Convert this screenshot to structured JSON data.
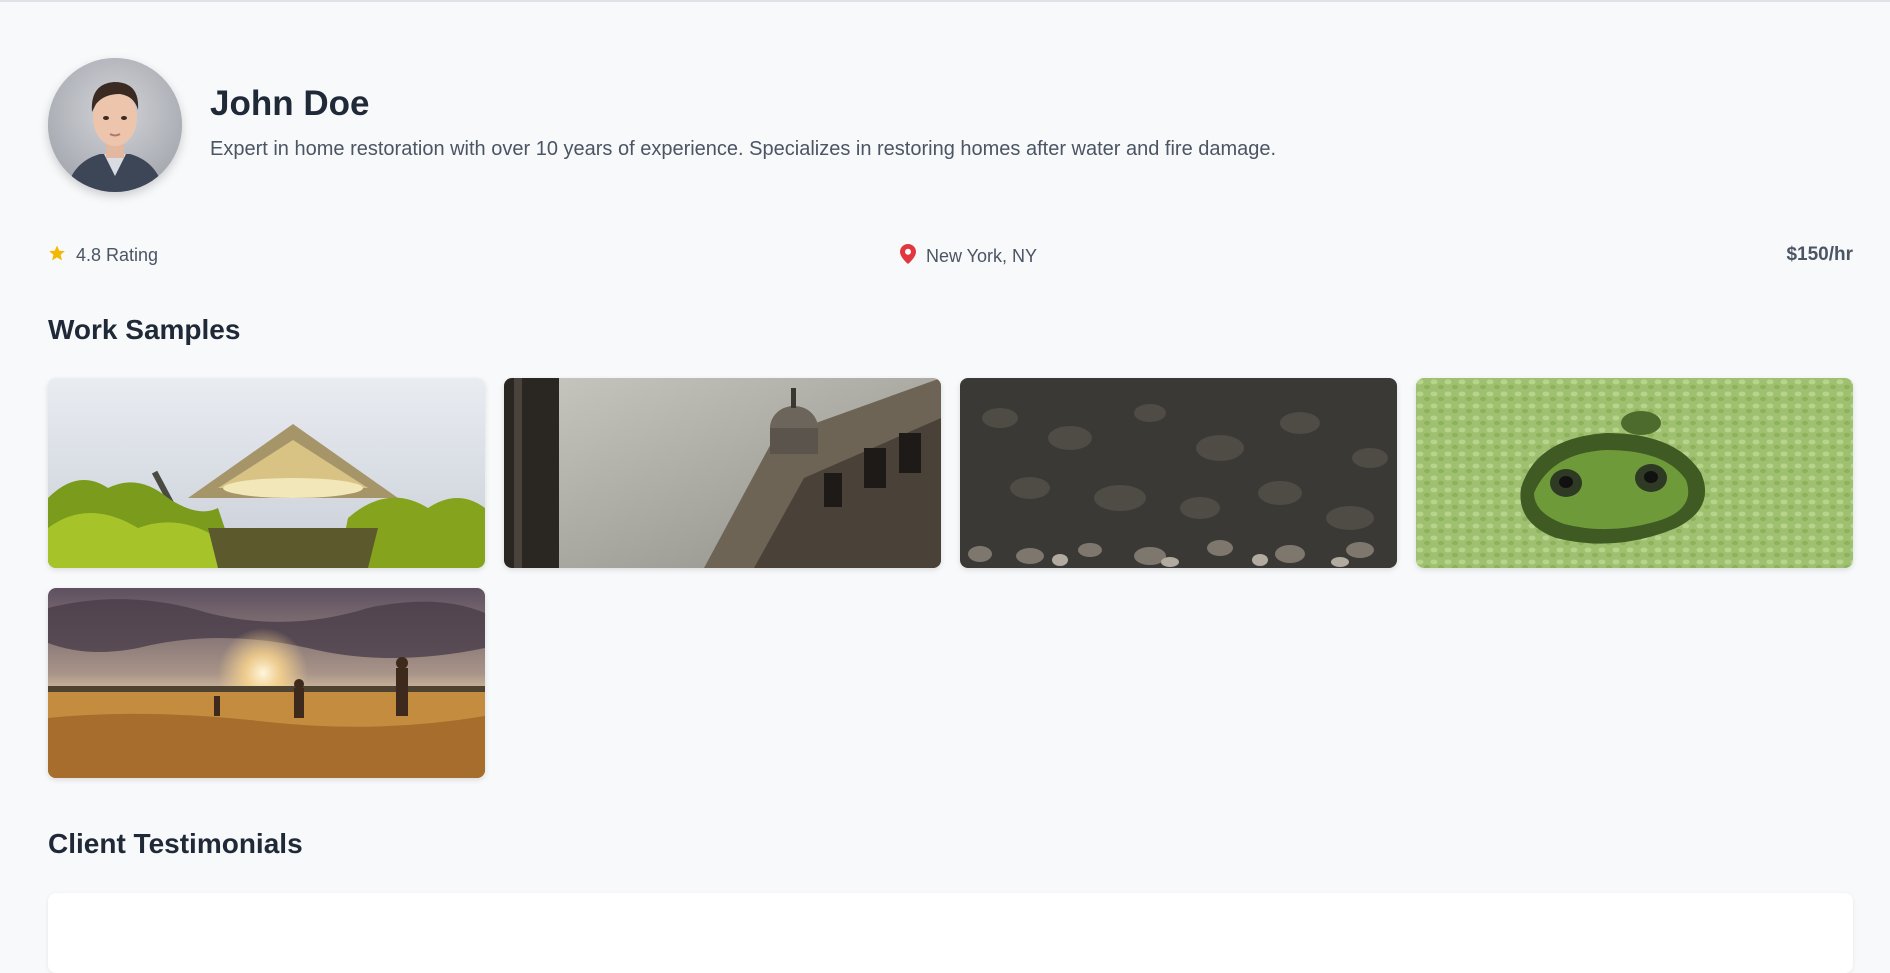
{
  "profile": {
    "name": "John Doe",
    "bio": "Expert in home restoration with over 10 years of experience. Specializes in restoring homes after water and fire damage.",
    "avatar_icon": "portrait-photo"
  },
  "stats": {
    "rating_label": "4.8 Rating",
    "rating_icon": "star-icon",
    "location_label": "New York, NY",
    "location_icon": "map-pin-icon",
    "rate_label": "$150/hr"
  },
  "colors": {
    "star": "#f5b800",
    "pin": "#e0383e",
    "background": "#f8f9fb",
    "heading": "#1f2937",
    "muted": "#4b5563"
  },
  "work_samples": {
    "title": "Work Samples",
    "items": [
      {
        "subject": "canoe-among-bushes-photo"
      },
      {
        "subject": "domed-building-photo"
      },
      {
        "subject": "dark-pebbles-photo"
      },
      {
        "subject": "frog-in-duckweed-photo"
      },
      {
        "subject": "sunset-field-photo"
      }
    ]
  },
  "testimonials": {
    "title": "Client Testimonials"
  }
}
